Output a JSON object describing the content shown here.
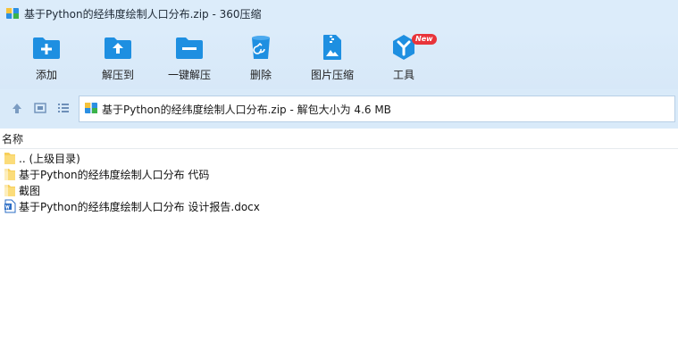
{
  "window": {
    "title": "基于Python的经纬度绘制人口分布.zip - 360压缩"
  },
  "toolbar": {
    "items": [
      {
        "label": "添加",
        "icon": "add-icon"
      },
      {
        "label": "解压到",
        "icon": "extract-to-icon"
      },
      {
        "label": "一键解压",
        "icon": "one-click-extract-icon"
      },
      {
        "label": "删除",
        "icon": "delete-icon"
      },
      {
        "label": "图片压缩",
        "icon": "image-compress-icon"
      },
      {
        "label": "工具",
        "icon": "tools-icon",
        "badge": "New"
      }
    ]
  },
  "address": {
    "path": "基于Python的经纬度绘制人口分布.zip - 解包大小为 4.6 MB"
  },
  "list": {
    "column_name": "名称",
    "rows": [
      {
        "name": ".. (上级目录)",
        "type": "folder"
      },
      {
        "name": "基于Python的经纬度绘制人口分布 代码",
        "type": "folder"
      },
      {
        "name": "截图",
        "type": "folder"
      },
      {
        "name": "基于Python的经纬度绘制人口分布 设计报告.docx",
        "type": "docx"
      }
    ]
  },
  "colors": {
    "accent": "#1e8fe1",
    "titlebar_bg": "#dcecfa",
    "folder": "#f7cf5a",
    "badge": "#e8343a"
  }
}
